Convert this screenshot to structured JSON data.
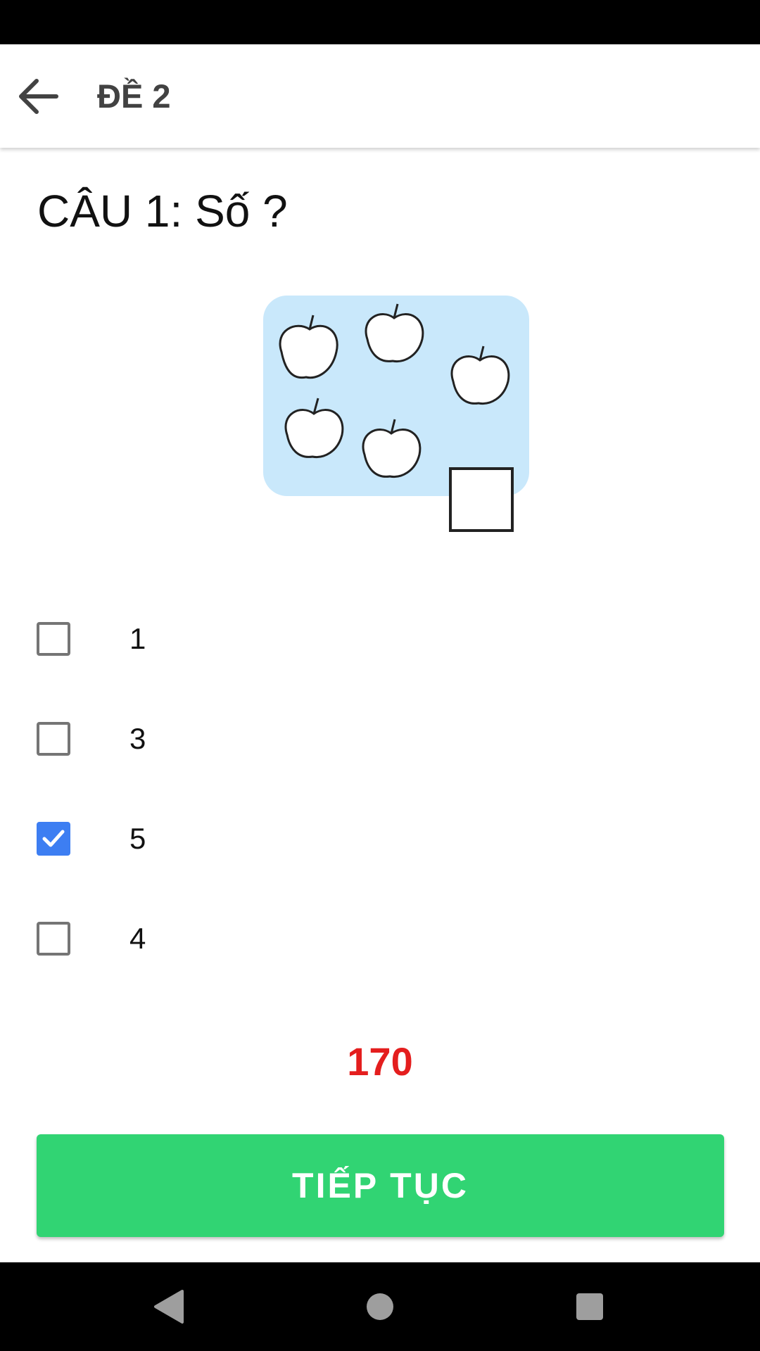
{
  "app_bar": {
    "back_icon": "arrow-left-icon",
    "title": "ĐỀ 2"
  },
  "question": {
    "title": "CÂU 1: Số ?",
    "image": {
      "description_icon": "apples-counting-picture",
      "background_color": "#c9e8fb",
      "apple_count": 5
    }
  },
  "options": [
    {
      "label": "1",
      "checked": false
    },
    {
      "label": "3",
      "checked": false
    },
    {
      "label": "5",
      "checked": true
    },
    {
      "label": "4",
      "checked": false
    }
  ],
  "timer": {
    "value": "170",
    "color": "#e41e1e"
  },
  "continue_button": {
    "label": "TIẾP TỤC",
    "color": "#31d473"
  },
  "nav_bar": {
    "back_icon": "nav-back-triangle-icon",
    "home_icon": "nav-home-circle-icon",
    "recents_icon": "nav-recents-square-icon"
  },
  "colors": {
    "checkbox_checked": "#3d7ef2",
    "checkbox_unchecked_border": "#757575"
  }
}
